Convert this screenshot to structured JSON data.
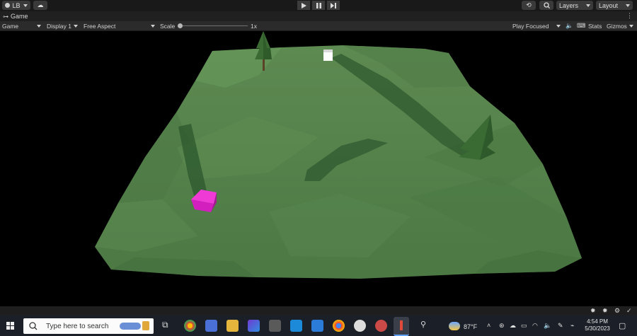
{
  "top": {
    "account": "LB",
    "history_icon": "history-icon",
    "search_icon": "search-icon",
    "layers": "Layers",
    "layout": "Layout"
  },
  "game_tab": {
    "label": "Game"
  },
  "toolbar": {
    "game": "Game",
    "display": "Display 1",
    "aspect": "Free Aspect",
    "scale_label": "Scale",
    "scale_value": "1x",
    "play_focused": "Play Focused",
    "stats": "Stats",
    "gizmos": "Gizmos"
  },
  "taskbar": {
    "search_placeholder": "Type here to search",
    "weather": "87°F",
    "time": "4:54 PM",
    "date": "5/30/2023"
  },
  "colors": {
    "terrain": "#55804a",
    "magenta_cube": "#d21fbe",
    "accent": "#0078d4"
  }
}
